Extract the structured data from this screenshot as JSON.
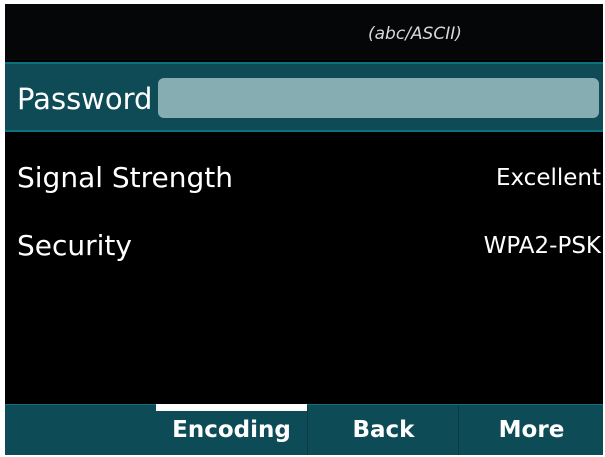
{
  "status_bar": {
    "input_mode": "(abc/ASCII)"
  },
  "password": {
    "label": "Password",
    "value": ""
  },
  "details": [
    {
      "label": "Signal Strength",
      "value": "Excellent"
    },
    {
      "label": "Security",
      "value": "WPA2-PSK"
    }
  ],
  "softkeys": [
    {
      "label": "",
      "selected": false
    },
    {
      "label": "Encoding",
      "selected": true
    },
    {
      "label": "Back",
      "selected": false
    },
    {
      "label": "More",
      "selected": false
    }
  ],
  "colors": {
    "background": "#000000",
    "accent_teal": "#0f4b57",
    "field_fill": "#86aeb2",
    "softkey_bar": "#0d4b56"
  }
}
